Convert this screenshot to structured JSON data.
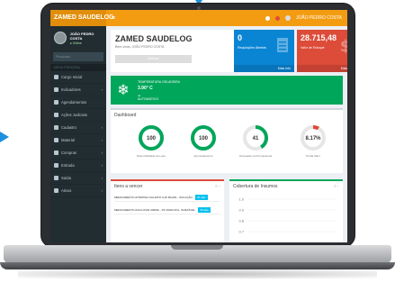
{
  "app": {
    "brand": "ZAMED SAUDELOG",
    "toggle": "≡",
    "user_top": "JOÃO PEDRO COSTA"
  },
  "sidebar": {
    "user_name": "JOÃO PEDRO COSTA",
    "user_status": "● Online",
    "search_placeholder": "Pesquisar...",
    "section_header": "MENU PRINCIPAL",
    "items": [
      {
        "label": "Cargo Inicial"
      },
      {
        "label": "Indicadores"
      },
      {
        "label": "Agendamentos"
      },
      {
        "label": "Ações Judiciais"
      },
      {
        "label": "Cadastro"
      },
      {
        "label": "Material"
      },
      {
        "label": "Compras"
      },
      {
        "label": "Entrada"
      },
      {
        "label": "Saída"
      },
      {
        "label": "Ativos"
      }
    ]
  },
  "header_box": {
    "title": "ZAMED SAUDELOG",
    "subtitle": "Bem-vindo, JOÃO PEDRO COSTA",
    "button": "Acessar"
  },
  "kpis": [
    {
      "value": "0",
      "label": "Requisições Abertas",
      "more": "Mais Info",
      "color": "#0a85d4"
    },
    {
      "value": "28.715,48",
      "label": "Valor de Estoque",
      "more": "Mais Info",
      "color": "#dd4b39"
    }
  ],
  "temperature": {
    "title": "TEMPERATURA GELADEIRA",
    "value": "3.90° C",
    "meta": "ok",
    "status": "AUTOMÁTICO"
  },
  "dashboard": {
    "title": "Dashboard",
    "gauges": [
      {
        "value": "100",
        "fraction": 1.0,
        "label": "Disponibilidade de Leito",
        "color": "#00a65a"
      },
      {
        "value": "100",
        "fraction": 1.0,
        "label": "Aproveitamento",
        "color": "#00a65a"
      },
      {
        "value": "41",
        "fraction": 0.41,
        "label": "Ocupação na Permanência",
        "color": "#00a65a"
      },
      {
        "value": "8.17%",
        "fraction": 0.0817,
        "label": "Perda Valor",
        "color": "#dd4b39"
      }
    ]
  },
  "panel_left": {
    "title": "Itens a vencer",
    "tools": "≡ −",
    "rows": [
      {
        "text": "MEDICAMENTO ATROPINA SULFATO 0,25 MG/ML - SOLUÇÃO",
        "badge": "30 dias"
      },
      {
        "text": "MEDICAMENTO ACICLOVIR 200MG - PO PARA SOL. INJETÁVEL",
        "badge": "45 dias"
      }
    ]
  },
  "panel_right": {
    "title": "Cobertura de Insumos",
    "tools": "≡ −",
    "y_ticks": [
      "1.0",
      "0.9",
      "0.8",
      "0.7"
    ]
  },
  "colors": {
    "accent": "#f39c12",
    "sidebar": "#222d32",
    "green": "#00a65a",
    "blue": "#0a85d4",
    "red": "#dd4b39"
  }
}
